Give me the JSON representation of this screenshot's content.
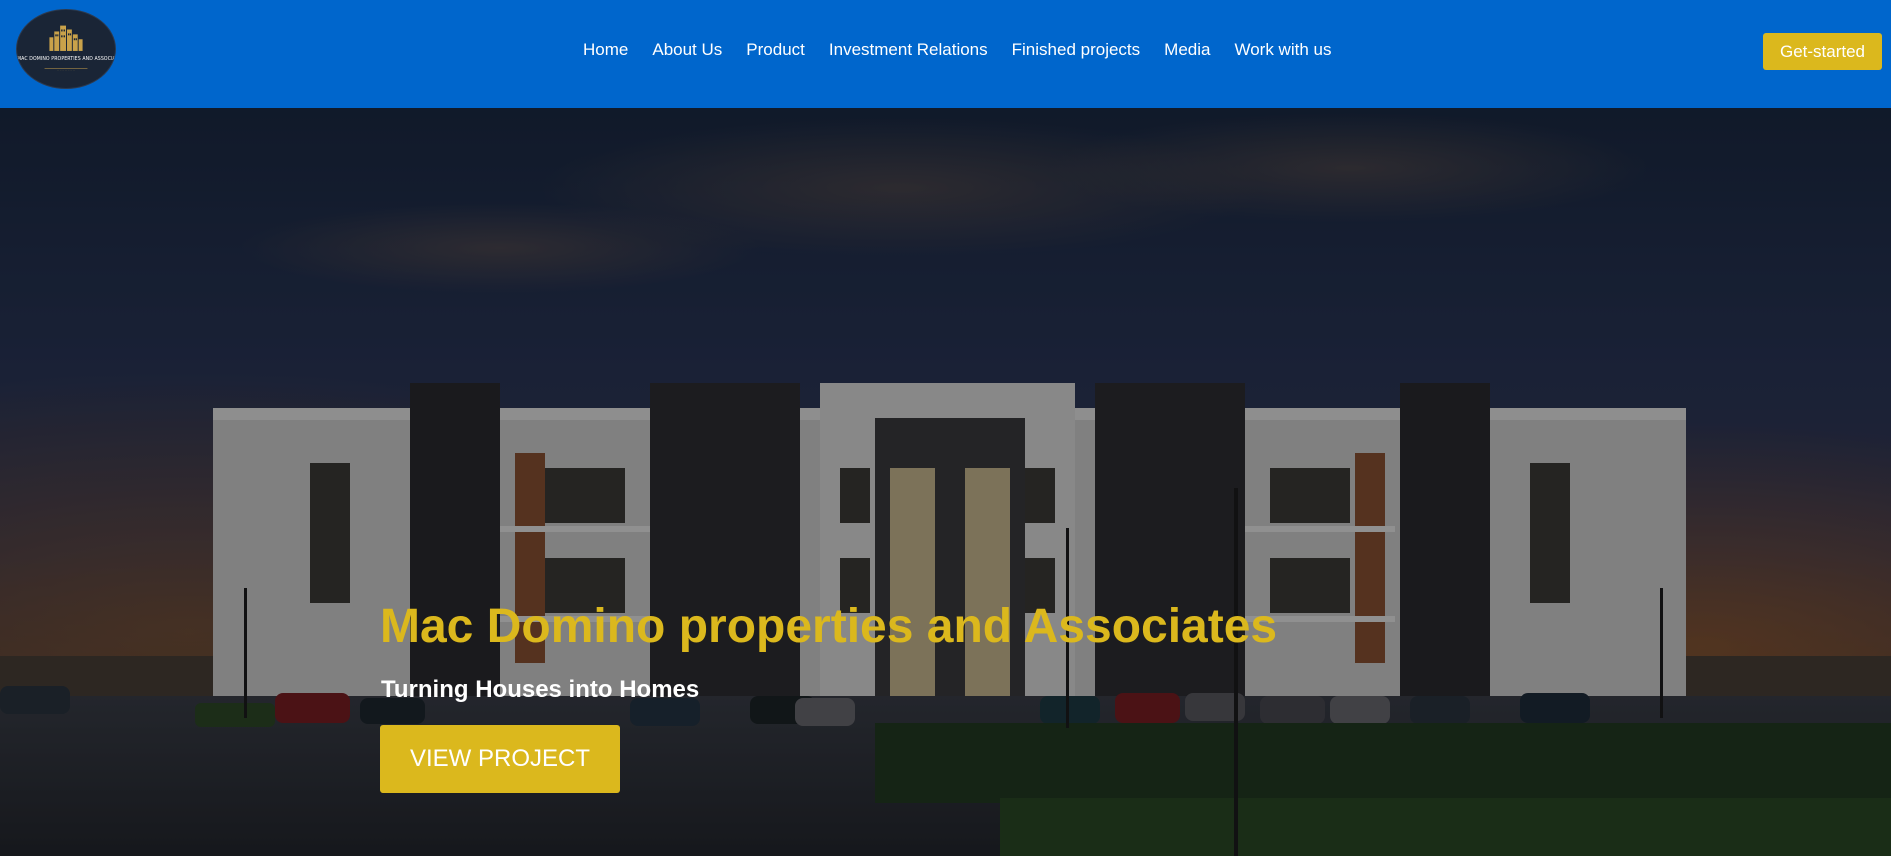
{
  "header": {
    "logo": {
      "icon": "building-icon",
      "text": "MAC DOMINO PROPERTIES AND ASSOCIATES"
    },
    "nav": [
      {
        "label": "Home"
      },
      {
        "label": "About Us"
      },
      {
        "label": "Product"
      },
      {
        "label": "Investment Relations"
      },
      {
        "label": "Finished projects"
      },
      {
        "label": "Media"
      },
      {
        "label": "Work with us"
      }
    ],
    "cta_label": "Get-started"
  },
  "hero": {
    "title": "Mac Domino properties and Associates",
    "subtitle": "Turning Houses into Homes",
    "button_label": "VIEW PROJECT"
  },
  "colors": {
    "header_bg": "#0066cc",
    "accent_gold": "#dbb81d",
    "text_white": "#ffffff"
  }
}
